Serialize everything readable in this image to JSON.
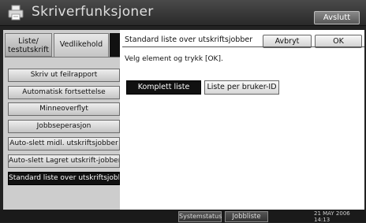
{
  "header": {
    "title": "Skriverfunksjoner",
    "exit_label": "Avslutt",
    "icon": "printer-icon"
  },
  "tabs": [
    {
      "label_line1": "Liste/",
      "label_line2": "testutskrift"
    },
    {
      "label": "Vedlikehold"
    }
  ],
  "menu": {
    "items": [
      "Skriv ut feilrapport",
      "Automatisk fortsettelse",
      "Minneoverflyt",
      "Jobbseperasjon",
      "Auto-slett midl. utskriftsjobber",
      "Auto-slett Lagret utskrift-jobber",
      "Standard liste over utskriftsjobber"
    ],
    "selected_index": 6
  },
  "dialog": {
    "title": "Standard liste over utskriftsjobber",
    "cancel_label": "Avbryt",
    "ok_label": "OK",
    "instruction": "Velg element og trykk [OK].",
    "options": [
      "Komplett liste",
      "Liste per bruker-ID"
    ],
    "selected_option": 0
  },
  "bottom": {
    "system_status_label": "Systemstatus",
    "job_list_label": "Jobbliste",
    "date": "21 MAY  2006",
    "time": "14:13"
  },
  "colors": {
    "header_bg": "#3a3a3a",
    "selected_bg": "#111111",
    "panel_bg": "#cdcdcd"
  }
}
